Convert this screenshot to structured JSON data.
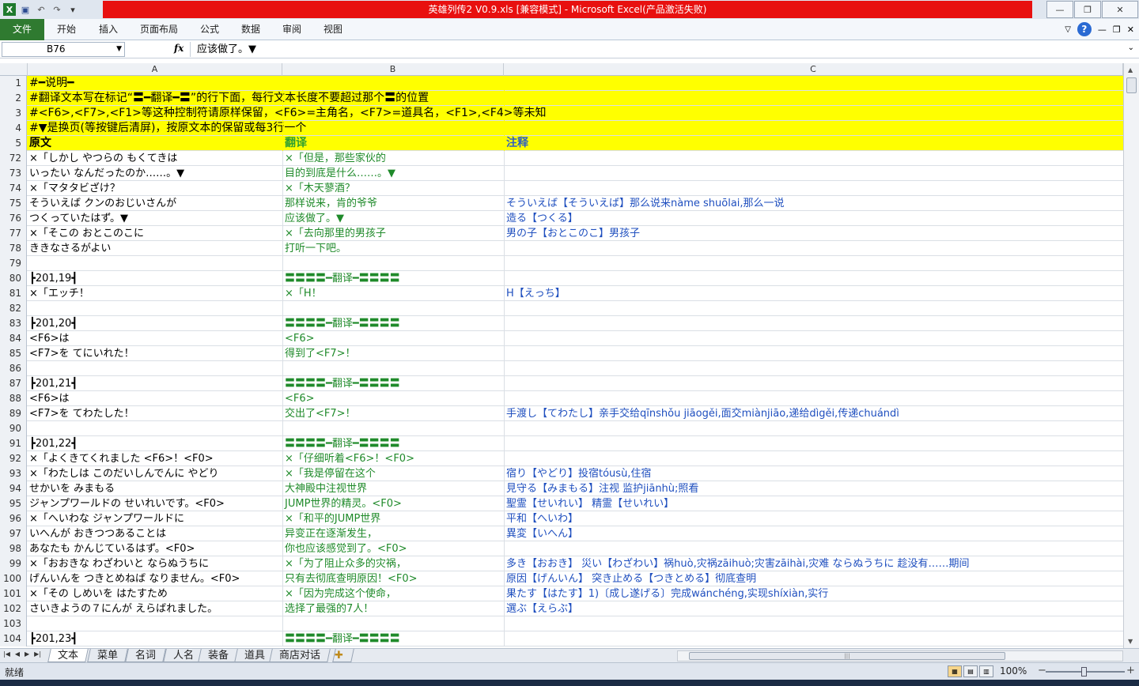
{
  "window": {
    "title": "英雄列传2 V0.9.xls  [兼容模式] - Microsoft Excel(产品激活失败)",
    "controls": [
      "—",
      "❐",
      "✕"
    ]
  },
  "ribbon": {
    "file_tab": "文件",
    "tabs": [
      "开始",
      "插入",
      "页面布局",
      "公式",
      "数据",
      "审阅",
      "视图"
    ]
  },
  "formula_bar": {
    "name_box": "B76",
    "fx": "fx",
    "content": "应该做了。▼"
  },
  "columns": [
    "A",
    "B",
    "C"
  ],
  "rows": [
    {
      "num": "1",
      "a": "#━说明━",
      "b": "",
      "c": "",
      "style": "yellow note"
    },
    {
      "num": "2",
      "a": "#翻译文本写在标记“〓━翻译━〓”的行下面，每行文本长度不要超过那个〓的位置",
      "b": "",
      "c": "",
      "style": "yellow note"
    },
    {
      "num": "3",
      "a": "#<F6>,<F7>,<F1>等这种控制符请原样保留，<F6>=主角名，<F7>=道具名，<F1>,<F4>等未知",
      "b": "",
      "c": "",
      "style": "yellow note"
    },
    {
      "num": "4",
      "a": "#▼是换页(等按键后清屏)，按原文本的保留或每3行一个",
      "b": "",
      "c": "",
      "style": "yellow note"
    },
    {
      "num": "5",
      "a": "原文",
      "b": "翻译",
      "c": "注释",
      "style": "yellow hdr"
    },
    {
      "num": "72",
      "a": "×「しかし やつらの もくてきは",
      "b": "×「但是，那些家伙的",
      "c": "",
      "style": ""
    },
    {
      "num": "73",
      "a": "いったい なんだったのか……。▼",
      "b": "目的到底是什么……。▼",
      "c": "",
      "style": ""
    },
    {
      "num": "74",
      "a": "×「マタタビざけ？",
      "b": "×「木天蓼酒？",
      "c": "",
      "style": ""
    },
    {
      "num": "75",
      "a": "そういえば クンのおじいさんが",
      "b": "那样说来，肯的爷爷",
      "c": "そういえば【そういえば】那么说来nàme shuōlai,那么一说",
      "style": ""
    },
    {
      "num": "76",
      "a": "つくっていたはず。▼",
      "b": "应该做了。▼",
      "c": "造る【つくる】",
      "style": ""
    },
    {
      "num": "77",
      "a": "×「そこの おとこのこに",
      "b": "×「去向那里的男孩子",
      "c": "男の子【おとこのこ】男孩子",
      "style": ""
    },
    {
      "num": "78",
      "a": "ききなさるがよい",
      "b": "打听一下吧。",
      "c": "",
      "style": ""
    },
    {
      "num": "79",
      "a": "",
      "b": "",
      "c": "",
      "style": ""
    },
    {
      "num": "80",
      "a": "┣201,19┫",
      "b": "〓〓〓〓━翻译━〓〓〓〓",
      "c": "",
      "style": ""
    },
    {
      "num": "81",
      "a": "×「エッチ！",
      "b": "×「H！",
      "c": "H【えっち】",
      "style": ""
    },
    {
      "num": "82",
      "a": "",
      "b": "",
      "c": "",
      "style": ""
    },
    {
      "num": "83",
      "a": "┣201,20┫",
      "b": "〓〓〓〓━翻译━〓〓〓〓",
      "c": "",
      "style": ""
    },
    {
      "num": "84",
      "a": "<F6>は",
      "b": "<F6>",
      "c": "",
      "style": ""
    },
    {
      "num": "85",
      "a": "<F7>を てにいれた！",
      "b": "得到了<F7>！",
      "c": "",
      "style": ""
    },
    {
      "num": "86",
      "a": "",
      "b": "",
      "c": "",
      "style": ""
    },
    {
      "num": "87",
      "a": "┣201,21┫",
      "b": "〓〓〓〓━翻译━〓〓〓〓",
      "c": "",
      "style": ""
    },
    {
      "num": "88",
      "a": "<F6>は",
      "b": "<F6>",
      "c": "",
      "style": ""
    },
    {
      "num": "89",
      "a": "<F7>を てわたした！",
      "b": "交出了<F7>！",
      "c": "手渡し【てわたし】亲手交给qīnshǒu jiāogěi,面交miànjiāo,递给dìgěi,传递chuándì",
      "style": ""
    },
    {
      "num": "90",
      "a": "",
      "b": "",
      "c": "",
      "style": ""
    },
    {
      "num": "91",
      "a": "┣201,22┫",
      "b": "〓〓〓〓━翻译━〓〓〓〓",
      "c": "",
      "style": ""
    },
    {
      "num": "92",
      "a": "×「よくきてくれました <F6>！<F0>",
      "b": "×「仔细听着<F6>！<F0>",
      "c": "",
      "style": ""
    },
    {
      "num": "93",
      "a": "×「わたしは このだいしんでんに やどり",
      "b": "×「我是停留在这个",
      "c": "宿り【やどり】投宿tóusù,住宿",
      "style": ""
    },
    {
      "num": "94",
      "a": "せかいを みまもる",
      "b": "大神殿中注视世界",
      "c": "見守る【みまもる】注视 监护jiānhù;照看",
      "style": ""
    },
    {
      "num": "95",
      "a": "ジャンプワールドの せいれいです。<F0>",
      "b": "JUMP世界的精灵。<F0>",
      "c": "聖霊【せいれい】 精霊【せいれい】",
      "style": ""
    },
    {
      "num": "96",
      "a": "×「へいわな ジャンプワールドに",
      "b": "×「和平的JUMP世界",
      "c": "平和【へいわ】",
      "style": ""
    },
    {
      "num": "97",
      "a": "いへんが おきつつあることは",
      "b": "异变正在逐渐发生，",
      "c": "異変【いへん】",
      "style": ""
    },
    {
      "num": "98",
      "a": "あなたも かんじているはず。<F0>",
      "b": "你也应该感觉到了。<F0>",
      "c": "",
      "style": ""
    },
    {
      "num": "99",
      "a": "×「おおきな わざわいと ならぬうちに",
      "b": "×「为了阻止众多的灾祸，",
      "c": "多き【おおき】 災い【わざわい】祸huò,灾祸zāihuò;灾害zāihài,灾难 ならぬうちに 趁没有……期间",
      "style": ""
    },
    {
      "num": "100",
      "a": "げんいんを つきとめねば なりません。<F0>",
      "b": "只有去彻底查明原因！<F0>",
      "c": "原因【げんいん】 突き止める【つきとめる】彻底查明",
      "style": ""
    },
    {
      "num": "101",
      "a": "×「その しめいを はたすため",
      "b": "×「因为完成这个使命，",
      "c": "果たす【はたす】1)〔成し遂げる〕完成wánchéng,实现shíxiàn,实行",
      "style": ""
    },
    {
      "num": "102",
      "a": "さいきようの７にんが えらばれました。",
      "b": "选择了最强的7人！",
      "c": "選ぶ【えらぶ】",
      "style": ""
    },
    {
      "num": "103",
      "a": "",
      "b": "",
      "c": "",
      "style": ""
    },
    {
      "num": "104",
      "a": "┣201,23┫",
      "b": "〓〓〓〓━翻译━〓〓〓〓",
      "c": "",
      "style": ""
    }
  ],
  "sheet_tabs": [
    {
      "label": "文本",
      "active": true
    },
    {
      "label": "菜单",
      "active": false
    },
    {
      "label": "名词",
      "active": false
    },
    {
      "label": "人名",
      "active": false
    },
    {
      "label": "装备",
      "active": false
    },
    {
      "label": "道具",
      "active": false
    },
    {
      "label": "商店对话",
      "active": false
    }
  ],
  "status": {
    "ready": "就绪",
    "zoom": "100%",
    "zoom_minus": "−",
    "zoom_plus": "+"
  },
  "colors": {
    "title_bar": "#e8100f",
    "file_tab": "#2f7a30",
    "header_fill": "#ffff00",
    "translation_text": "#1f8a2a",
    "note_text": "#1f4fbf"
  }
}
